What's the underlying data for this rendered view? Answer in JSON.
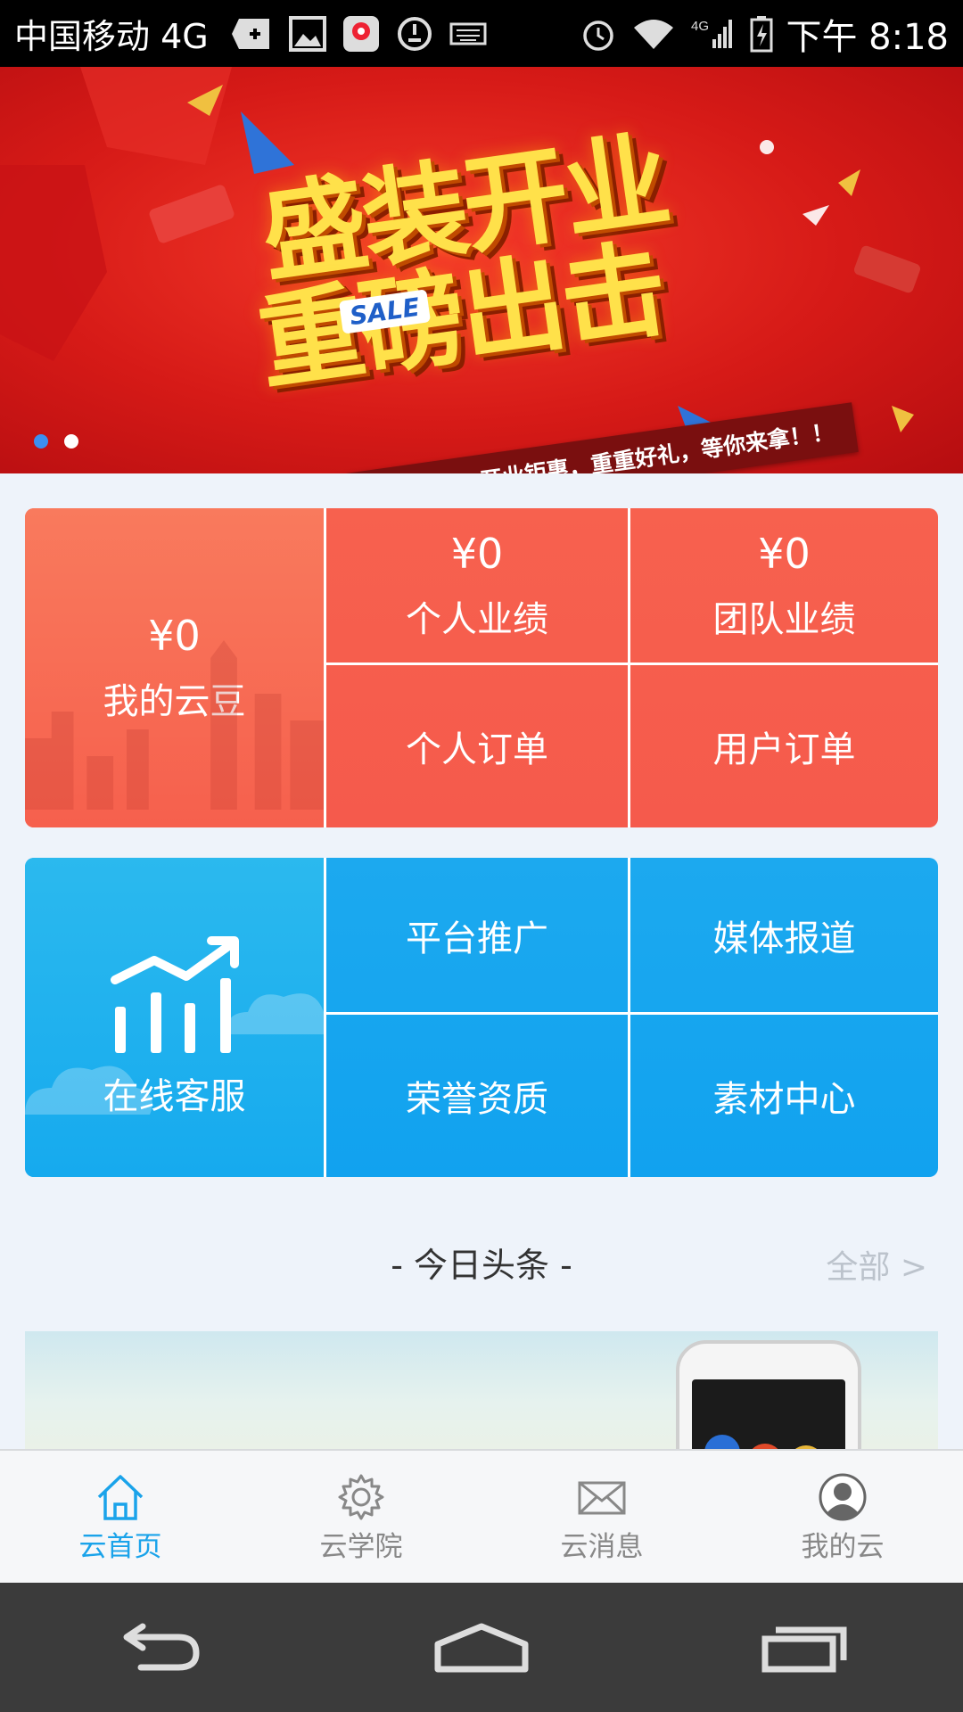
{
  "status_bar": {
    "carrier": "中国移动 4G",
    "network": "4G",
    "time_prefix": "下午",
    "time": "8:18"
  },
  "banner": {
    "headline_line1": "盛装开业",
    "headline_line2": "重磅出击",
    "sale_badge": "SALE",
    "tagline": "河北双创云端 ，开业钜惠，重重好礼，等你来拿！！",
    "page_count": 2,
    "active_page": 1
  },
  "stats_panel": {
    "cloud_beans": {
      "amount": "¥0",
      "label": "我的云豆"
    },
    "personal_performance": {
      "amount": "¥0",
      "label": "个人业绩"
    },
    "team_performance": {
      "amount": "¥0",
      "label": "团队业绩"
    },
    "personal_orders": {
      "label": "个人订单"
    },
    "user_orders": {
      "label": "用户订单"
    }
  },
  "service_panel": {
    "online_service": {
      "label": "在线客服",
      "icon": "chart-trend-icon"
    },
    "platform_promo": "平台推广",
    "media_reports": "媒体报道",
    "honors": "荣誉资质",
    "materials": "素材中心"
  },
  "news": {
    "title": "- 今日头条 -",
    "more": "全部 >"
  },
  "tabbar": {
    "items": [
      {
        "label": "云首页",
        "icon": "home-icon",
        "active": true
      },
      {
        "label": "云学院",
        "icon": "gear-icon",
        "active": false
      },
      {
        "label": "云消息",
        "icon": "mail-icon",
        "active": false
      },
      {
        "label": "我的云",
        "icon": "user-icon",
        "active": false
      }
    ]
  },
  "colors": {
    "accent_blue": "#1aa3ea",
    "panel_red": "#f55a4c",
    "panel_blue": "#11a2ef",
    "banner_red": "#d61a17",
    "banner_yellow": "#ffe14a"
  }
}
